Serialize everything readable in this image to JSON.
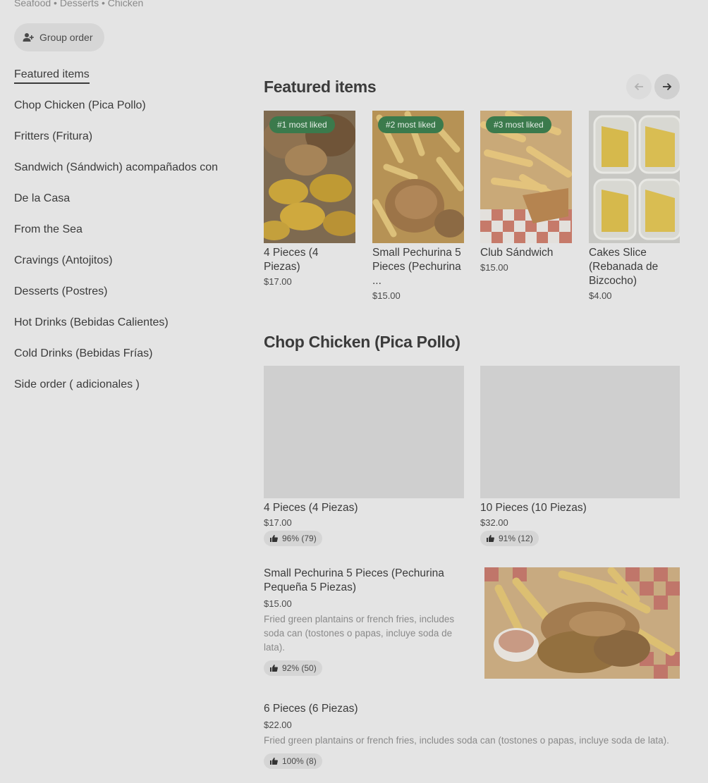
{
  "breadcrumb": "Seafood • Desserts • Chicken",
  "group_order_label": "Group order",
  "nav": [
    "Featured items",
    "Chop Chicken (Pica Pollo)",
    "Fritters (Fritura)",
    "Sandwich (Sándwich) acompañados con",
    "De la Casa",
    "From the Sea",
    "Cravings (Antojitos)",
    "Desserts (Postres)",
    "Hot Drinks (Bebidas Calientes)",
    "Cold Drinks (Bebidas Frías)",
    "Side order ( adicionales )"
  ],
  "featured": {
    "title": "Featured items",
    "items": [
      {
        "badge": "#1 most liked",
        "name": "4 Pieces (4 Piezas)",
        "price": "$17.00",
        "image": "fried-chicken-tostones"
      },
      {
        "badge": "#2 most liked",
        "name": "Small Pechurina 5 Pieces (Pechurina ...",
        "price": "$15.00",
        "image": "chicken-tenders-fries"
      },
      {
        "badge": "#3 most liked",
        "name": "Club Sándwich",
        "price": "$15.00",
        "image": "club-sandwich-fries"
      },
      {
        "badge": "",
        "name": "Cakes Slice (Rebanada de Bizcocho)",
        "price": "$4.00",
        "image": "cake-slices"
      }
    ]
  },
  "chop": {
    "title": "Chop Chicken (Pica Pollo)",
    "grid": [
      {
        "name": "4 Pieces (4 Piezas)",
        "price": "$17.00",
        "rating": "96% (79)"
      },
      {
        "name": "10 Pieces (10 Piezas)",
        "price": "$32.00",
        "rating": "91% (12)"
      }
    ],
    "list": [
      {
        "name": "Small Pechurina 5 Pieces (Pechurina Pequeña 5 Piezas)",
        "price": "$15.00",
        "desc": "Fried green plantains or french fries, includes soda can (tostones o papas, incluye soda de lata).",
        "rating": "92% (50)"
      },
      {
        "name": "6 Pieces (6 Piezas)",
        "price": "$22.00",
        "desc": "Fried green plantains or french fries, includes soda can (tostones o papas, incluye soda de lata).",
        "rating": "100% (8)"
      }
    ]
  },
  "colors": {
    "badge": "#3b7a4c",
    "background": "#e4e4e4",
    "text": "#3b3b3b"
  }
}
